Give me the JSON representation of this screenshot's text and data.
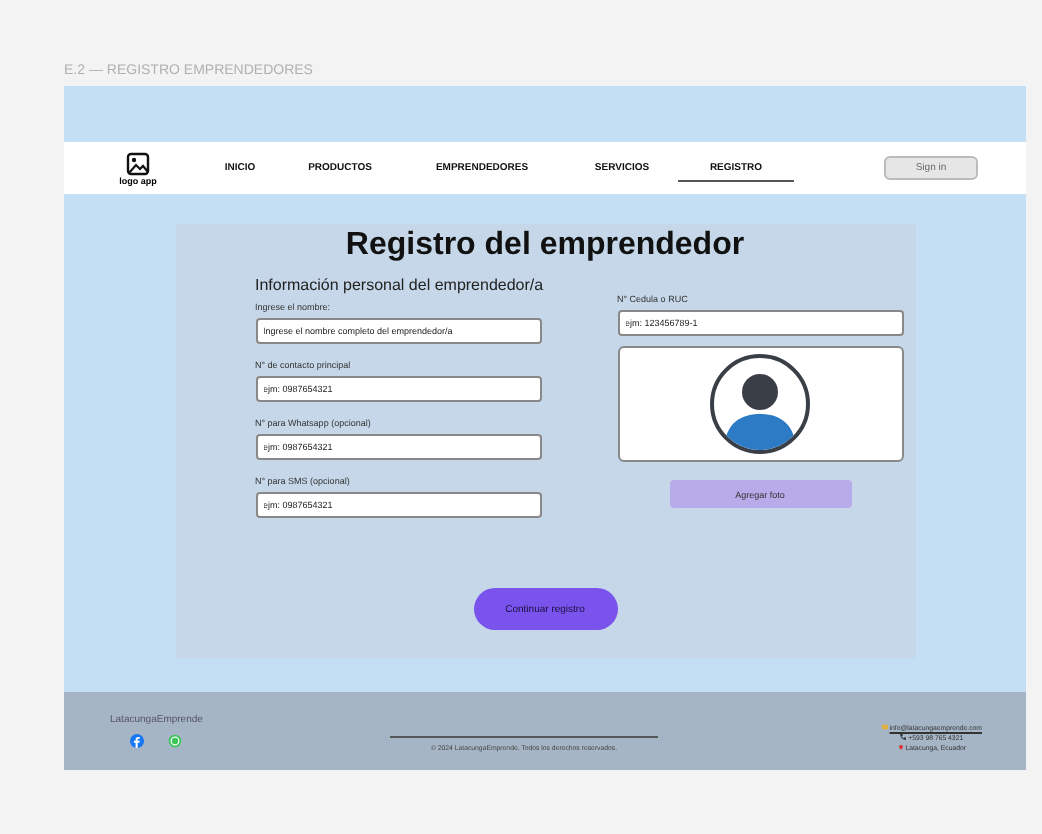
{
  "caption": "E.2 — REGISTRO EMPRENDEDORES",
  "nav": {
    "logo_label": "logo app",
    "items": [
      {
        "label": "INICIO",
        "selected": false
      },
      {
        "label": "PRODUCTOS",
        "selected": false
      },
      {
        "label": "EMPRENDEDORES",
        "selected": false
      },
      {
        "label": "SERVICIOS",
        "selected": false
      },
      {
        "label": "REGISTRO",
        "selected": true
      }
    ],
    "sign_in": "Sign in"
  },
  "form": {
    "title": "Registro del emprendedor",
    "section": "Información personal del emprendedor/a",
    "left_fields": [
      {
        "label": "Ingrese el nombre:",
        "value": "Ingrese el nombre completo del emprendedor/a"
      },
      {
        "label": "N° de contacto principal",
        "value": "ejm: 0987654321"
      },
      {
        "label": "N° para Whatsapp (opcional)",
        "value": "ejm: 0987654321"
      },
      {
        "label": "N° para SMS (opcional)",
        "value": "ejm: 0987654321"
      }
    ],
    "right_field": {
      "label": "N° Cedula o RUC",
      "value": "ejm: 123456789-1"
    },
    "photo_button": "Agregar foto",
    "submit": "Continuar registro"
  },
  "footer": {
    "brand": "LatacungaEmprende",
    "copyright": "© 2024 LatacungaEmprende. Todos los derechos reservados.",
    "contacts": [
      {
        "kind": "email",
        "text": "info@latacungaemprende.com"
      },
      {
        "kind": "phone",
        "text": "+593 98 765 4321"
      },
      {
        "kind": "location",
        "text": "Latacunga, Ecuador"
      }
    ]
  }
}
